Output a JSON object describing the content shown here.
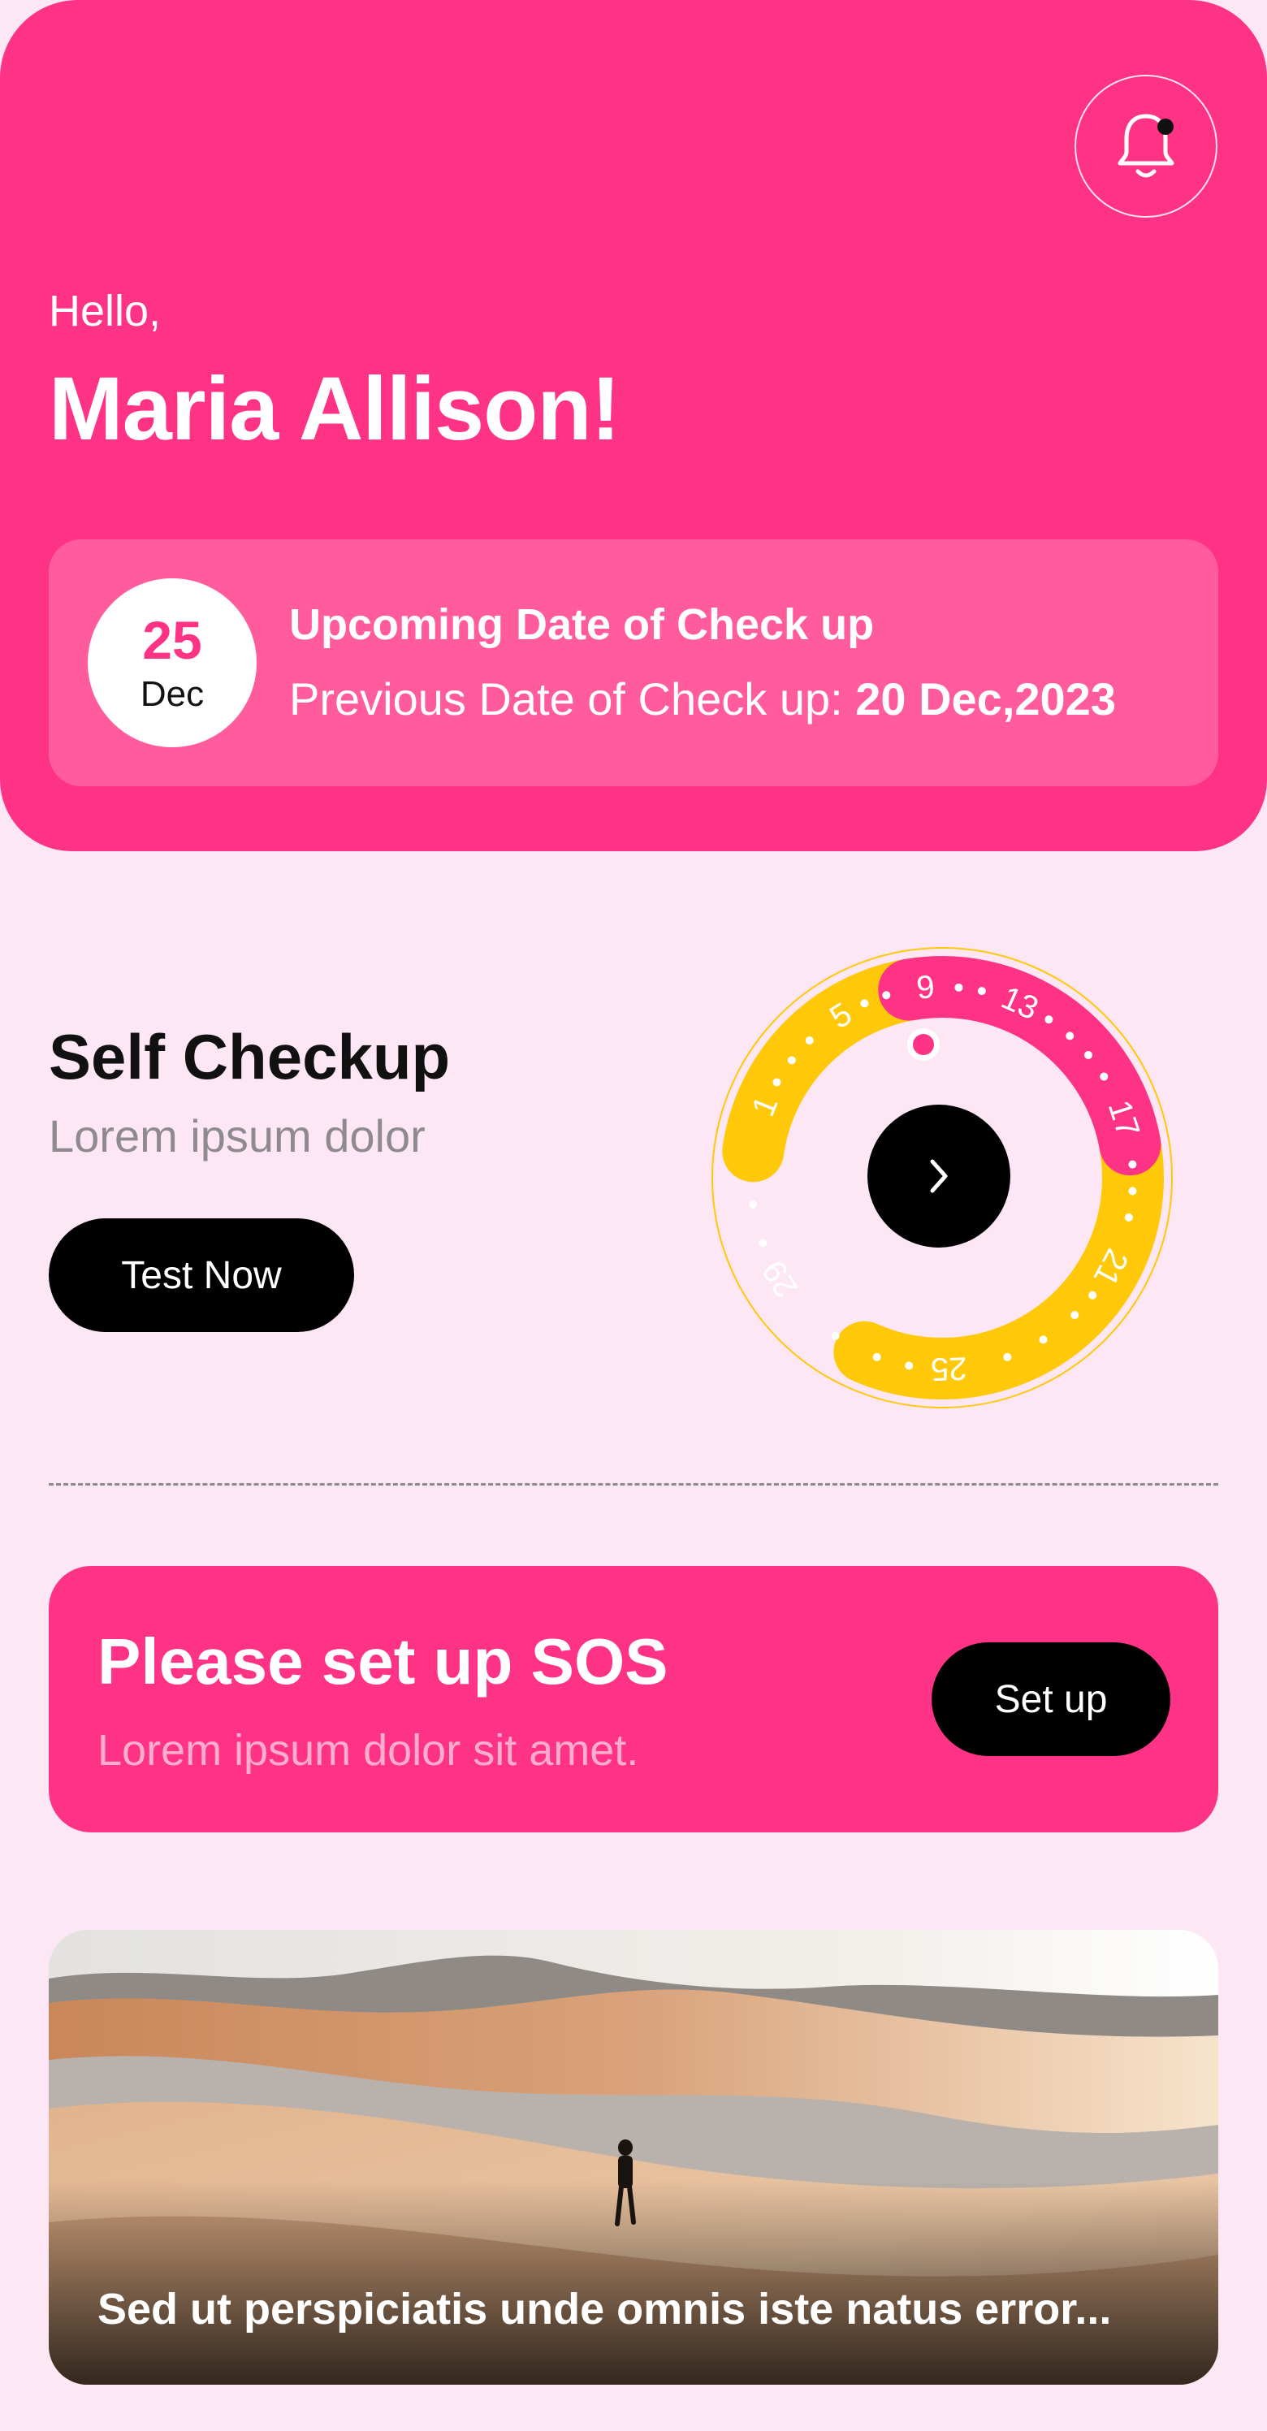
{
  "colors": {
    "primary": "#FF3385",
    "background": "#FDE7F4",
    "cycle_yellow": "#FFC90A",
    "black": "#000000"
  },
  "header": {
    "greeting": "Hello,",
    "user_name": "Maria Allison!",
    "notification_icon": "bell-icon"
  },
  "checkup": {
    "day": "25",
    "month": "Dec",
    "title": "Upcoming Date of Check up",
    "previous_label": "Previous Date of Check up: ",
    "previous_date": "20 Dec,2023"
  },
  "self_checkup": {
    "title": "Self Checkup",
    "subtitle": "Lorem ipsum dolor",
    "button_label": "Test Now",
    "cycle_days": [
      "1",
      "5",
      "9",
      "13",
      "17",
      "21",
      "25",
      "29"
    ],
    "arrow_icon": "chevron-right-icon"
  },
  "sos": {
    "title": "Please set up SOS",
    "subtitle": "Lorem ipsum dolor sit amet.",
    "button_label": "Set up"
  },
  "article": {
    "caption": "Sed ut perspiciatis unde omnis iste natus error..."
  }
}
